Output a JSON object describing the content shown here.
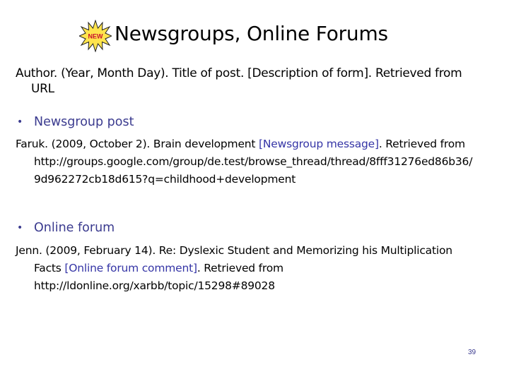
{
  "slide": {
    "badge_text": "NEW",
    "title": "Newsgroups, Online Forums",
    "format_line1": "Author. (Year, Month Day). Title of post. [Description of form]. Retrieved from",
    "format_line2": "URL",
    "colors": {
      "badge_fill": "#ffe44d",
      "badge_text": "#c8102e",
      "accent": "#3535a6"
    }
  },
  "sections": [
    {
      "bullet": "Newsgroup post",
      "lines": [
        {
          "pre": "Faruk. (2009, October 2). Brain development ",
          "hl": "[Newsgroup message]",
          "post": ". Retrieved from"
        },
        {
          "text": "http://groups.google.com/group/de.test/browse_thread/thread/8fff31276ed86b36/"
        },
        {
          "text": "9d962272cb18d615?q=childhood+development"
        }
      ]
    },
    {
      "bullet": "Online forum",
      "lines": [
        {
          "text": "Jenn. (2009, February 14). Re: Dyslexic Student and Memorizing his Multiplication"
        },
        {
          "pre": "Facts ",
          "hl": "[Online forum comment]",
          "post": ". Retrieved from"
        },
        {
          "text": "http://ldonline.org/xarbb/topic/15298#89028"
        }
      ]
    }
  ],
  "page_number": "39"
}
